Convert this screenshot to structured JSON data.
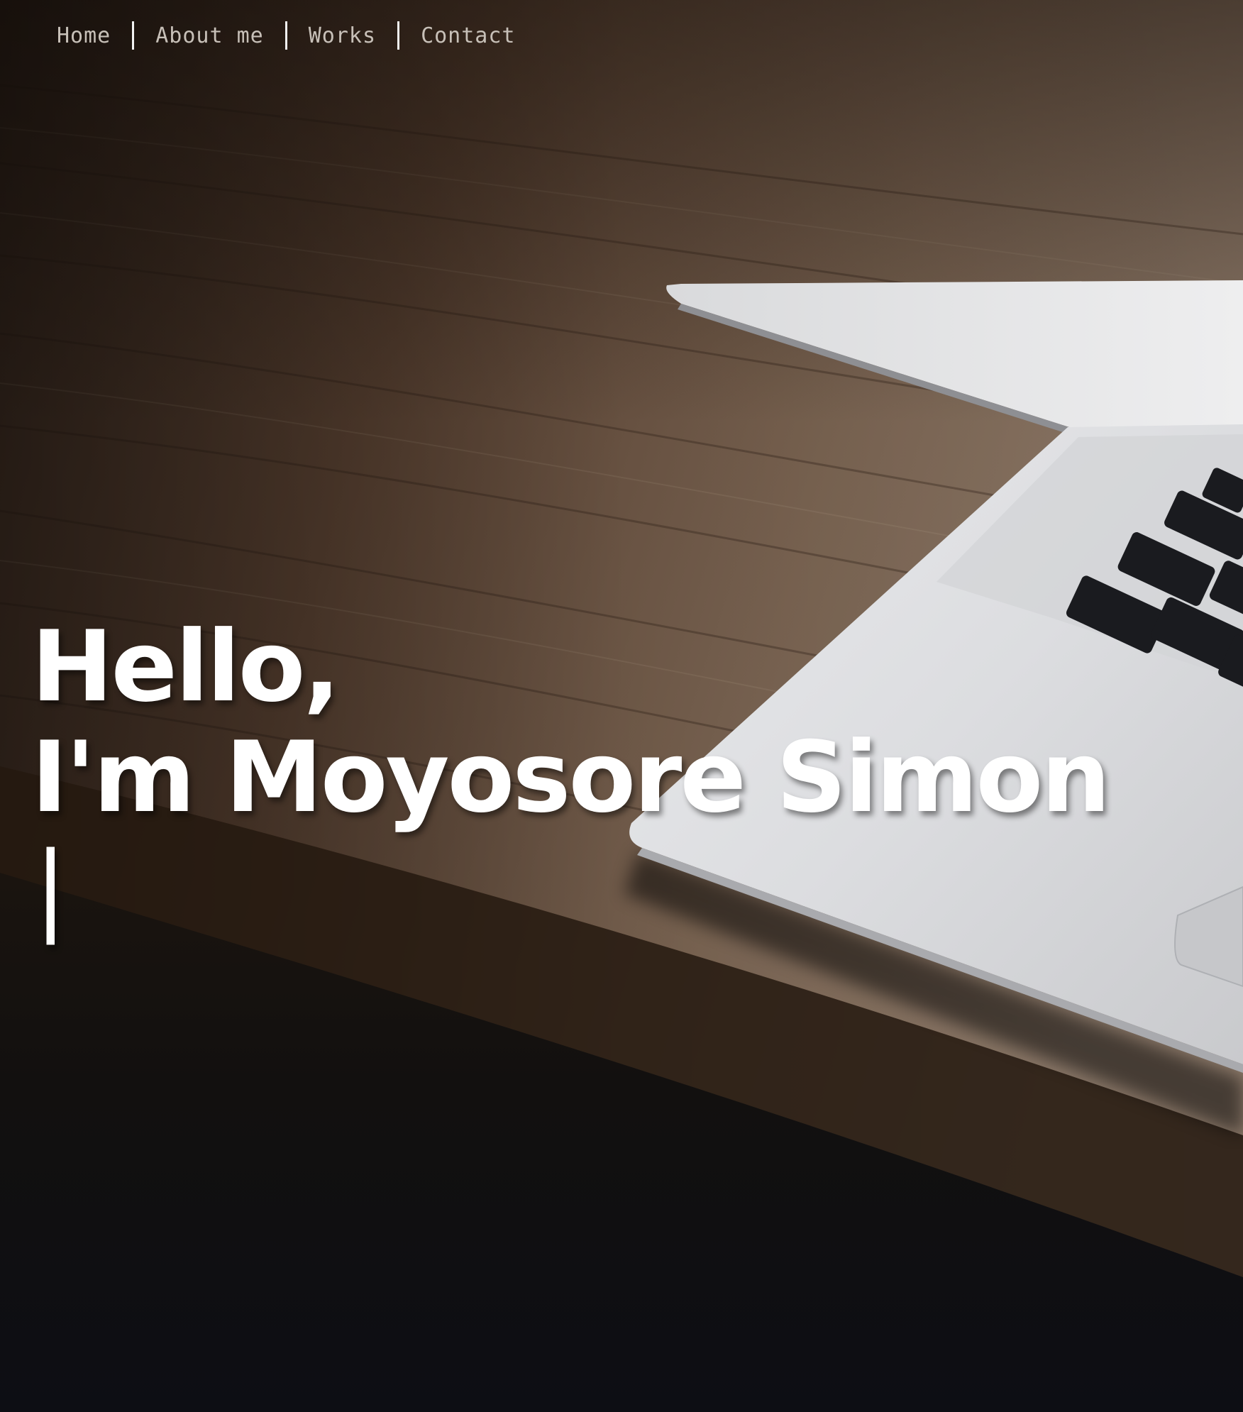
{
  "nav": {
    "items": [
      {
        "label": "Home"
      },
      {
        "label": "About me"
      },
      {
        "label": "Works"
      },
      {
        "label": "Contact"
      }
    ]
  },
  "hero": {
    "greeting": "Hello,",
    "intro_prefix": "I'm ",
    "name": "Moyosore Simon",
    "cursor": "|",
    "background_image": "wooden desk with silver laptop",
    "colors": {
      "heading_text": "#ffffff",
      "nav_text": "#c7c0b8",
      "nav_separator": "#f2f2f2",
      "page_bottom": "#0f1015"
    }
  }
}
